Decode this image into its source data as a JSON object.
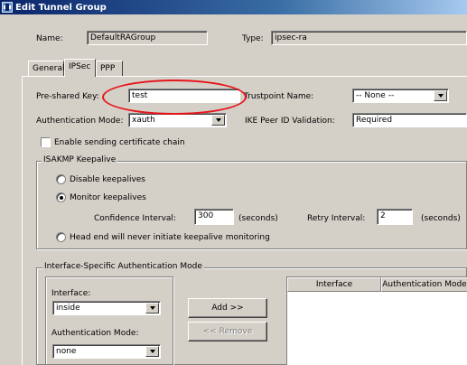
{
  "window": {
    "title": "Edit Tunnel Group",
    "icon": "tunnel-group-icon"
  },
  "header": {
    "name_label": "Name:",
    "name_value": "DefaultRAGroup",
    "type_label": "Type:",
    "type_value": "ipsec-ra"
  },
  "tabs": [
    {
      "label": "General",
      "active": false
    },
    {
      "label": "IPSec",
      "active": true
    },
    {
      "label": "PPP",
      "active": false
    }
  ],
  "ipsec": {
    "psk_label": "Pre-shared Key:",
    "psk_value": "test",
    "trustpoint_label": "Trustpoint Name:",
    "trustpoint_value": "-- None --",
    "auth_mode_label": "Authentication Mode:",
    "auth_mode_value": "xauth",
    "ike_peer_label": "IKE Peer ID Validation:",
    "ike_peer_value": "Required",
    "cert_chain_label": "Enable sending certificate chain",
    "cert_chain_checked": false
  },
  "keepalive": {
    "title": "ISAKMP Keepalive",
    "disable_label": "Disable keepalives",
    "monitor_label": "Monitor keepalives",
    "headend_label": "Head end will never initiate keepalive monitoring",
    "selected": "monitor",
    "confidence_label": "Confidence Interval:",
    "confidence_value": "300",
    "seconds_label_1": "(seconds)",
    "retry_label": "Retry Interval:",
    "retry_value": "2",
    "seconds_label_2": "(seconds)"
  },
  "iface_auth": {
    "title": "Interface-Specific Authentication Mode",
    "interface_label": "Interface:",
    "interface_value": "inside",
    "auth_mode_label": "Authentication Mode:",
    "auth_mode_value": "none",
    "add_button": "Add >>",
    "remove_button": "<< Remove",
    "table_headers": [
      "Interface",
      "Authentication Mode"
    ]
  },
  "colors": {
    "highlight": "#e8141c",
    "title_bar": "#0a246a",
    "dialog_bg": "#d4d0c8"
  }
}
